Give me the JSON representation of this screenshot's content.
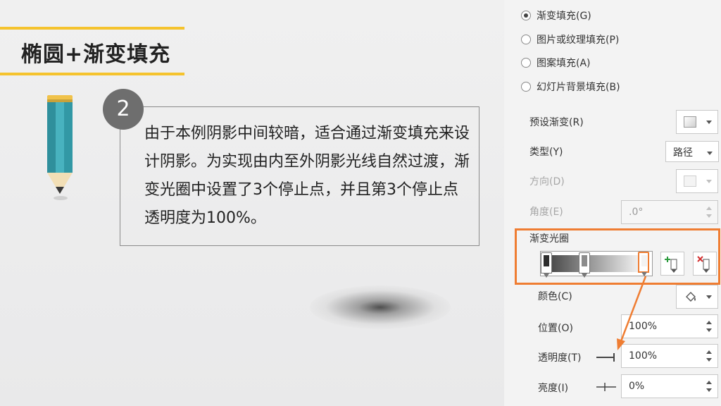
{
  "slide": {
    "title": "椭圆+渐变填充",
    "step_number": "2",
    "body_text": "由于本例阴影中间较暗，适合通过渐变填充来设计阴影。为实现由内至外阴影光线自然过渡，渐变光圈中设置了3个停止点，并且第3个停止点透明度为100%。"
  },
  "fill_options": [
    {
      "label": "渐变填充(G)",
      "selected": true
    },
    {
      "label": "图片或纹理填充(P)",
      "selected": false
    },
    {
      "label": "图案填充(A)",
      "selected": false
    },
    {
      "label": "幻灯片背景填充(B)",
      "selected": false
    }
  ],
  "props": {
    "preset_label": "预设渐变(R)",
    "type_label": "类型(Y)",
    "type_value": "路径",
    "direction_label": "方向(D)",
    "angle_label": "角度(E)",
    "angle_value": ".0°",
    "stops_label": "渐变光圈",
    "color_label": "颜色(C)",
    "position_label": "位置(O)",
    "position_value": "100%",
    "transparency_label": "透明度(T)",
    "transparency_value": "100%",
    "brightness_label": "亮度(I)",
    "brightness_value": "0%"
  },
  "gradient_stops": [
    {
      "color": "#2e2e2e",
      "position": 0
    },
    {
      "color": "#8c8c8c",
      "position": 38
    },
    {
      "color": "#f3f3f3",
      "position": 100
    }
  ],
  "colors": {
    "accent_orange": "#ef7d32",
    "title_rule_yellow": "#f5c32d",
    "pencil_teal": "#3fa7b5"
  }
}
